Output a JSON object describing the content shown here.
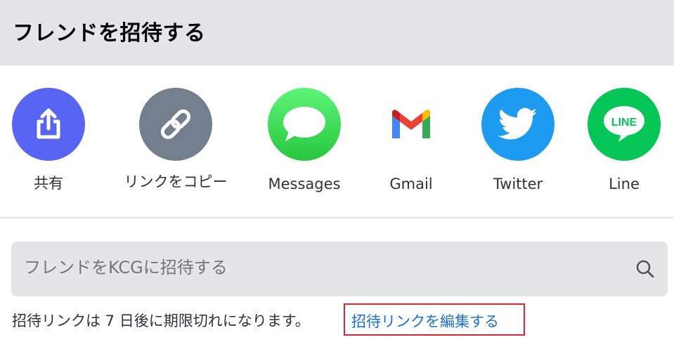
{
  "header": {
    "title": "フレンドを招待する"
  },
  "share_options": [
    {
      "label": "共有",
      "icon": "share-icon",
      "color": "#5865f2"
    },
    {
      "label": "リンクをコピー",
      "icon": "link-icon",
      "color": "#747f8d"
    },
    {
      "label": "Messages",
      "icon": "messages-icon",
      "color": "#34c759"
    },
    {
      "label": "Gmail",
      "icon": "gmail-icon",
      "color": "#ffffff"
    },
    {
      "label": "Twitter",
      "icon": "twitter-icon",
      "color": "#1d9bf0"
    },
    {
      "label": "Line",
      "icon": "line-icon",
      "color": "#06c755"
    }
  ],
  "search": {
    "placeholder": "フレンドをKCGに招待する"
  },
  "footer": {
    "expire_text": "招待リンクは 7 日後に期限切れになります。",
    "edit_link_label": "招待リンクを編集する"
  },
  "colors": {
    "link": "#1a6fd1",
    "highlight_border": "#e0242f"
  }
}
